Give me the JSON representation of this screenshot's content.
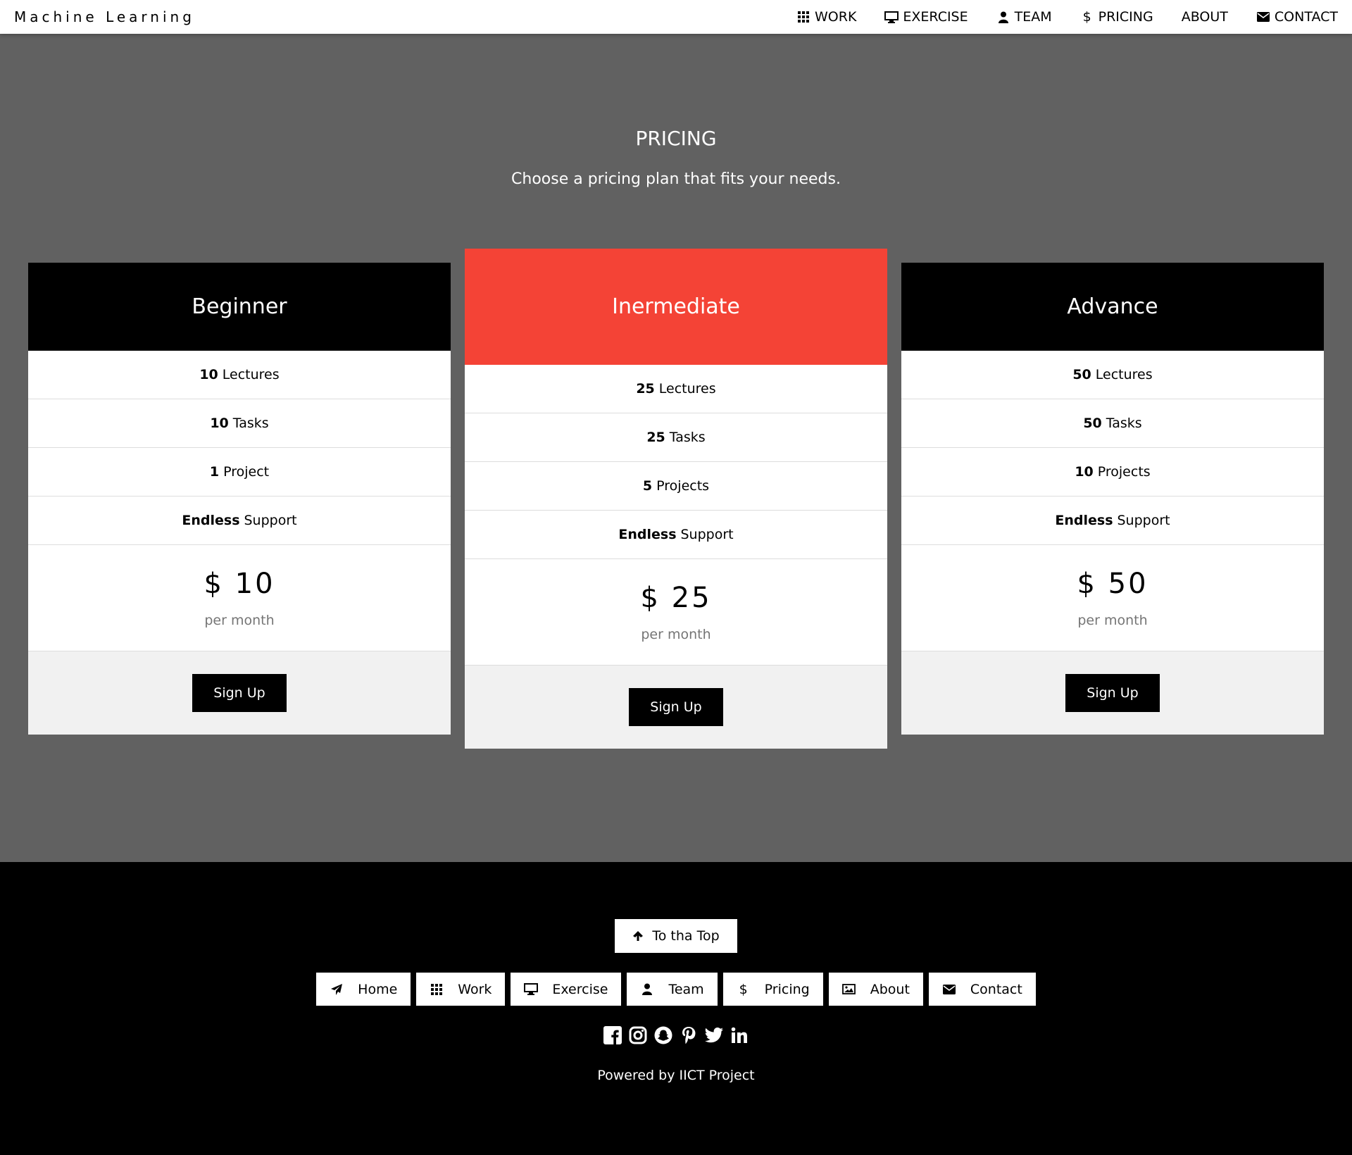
{
  "brand": "Machine Learning",
  "nav": [
    {
      "label": "WORK",
      "icon": "grid-icon"
    },
    {
      "label": "EXERCISE",
      "icon": "desktop-icon"
    },
    {
      "label": "TEAM",
      "icon": "user-icon"
    },
    {
      "label": "PRICING",
      "icon": "dollar-icon"
    },
    {
      "label": "ABOUT",
      "icon": ""
    },
    {
      "label": "CONTACT",
      "icon": "envelope-icon"
    }
  ],
  "pricing": {
    "title": "PRICING",
    "subtitle": "Choose a pricing plan that fits your needs."
  },
  "plans": [
    {
      "name": "Beginner",
      "features": [
        {
          "bold": "10",
          "text": "Lectures"
        },
        {
          "bold": "10",
          "text": "Tasks"
        },
        {
          "bold": "1",
          "text": "Project"
        },
        {
          "bold": "Endless",
          "text": "Support"
        }
      ],
      "price": "$ 10",
      "period": "per month",
      "button": "Sign Up"
    },
    {
      "name": "Inermediate",
      "features": [
        {
          "bold": "25",
          "text": "Lectures"
        },
        {
          "bold": "25",
          "text": "Tasks"
        },
        {
          "bold": "5",
          "text": "Projects"
        },
        {
          "bold": "Endless",
          "text": "Support"
        }
      ],
      "price": "$ 25",
      "period": "per month",
      "button": "Sign Up"
    },
    {
      "name": "Advance",
      "features": [
        {
          "bold": "50",
          "text": "Lectures"
        },
        {
          "bold": "50",
          "text": "Tasks"
        },
        {
          "bold": "10",
          "text": "Projects"
        },
        {
          "bold": "Endless",
          "text": "Support"
        }
      ],
      "price": "$ 50",
      "period": "per month",
      "button": "Sign Up"
    }
  ],
  "footer": {
    "to_top": "To tha Top",
    "links": [
      {
        "label": "Home",
        "icon": "paper-plane-icon"
      },
      {
        "label": "Work",
        "icon": "grid-icon"
      },
      {
        "label": "Exercise",
        "icon": "desktop-icon"
      },
      {
        "label": "Team",
        "icon": "user-icon"
      },
      {
        "label": "Pricing",
        "icon": "dollar-icon"
      },
      {
        "label": "About",
        "icon": "image-icon"
      },
      {
        "label": "Contact",
        "icon": "envelope-icon"
      }
    ],
    "social": [
      "facebook-icon",
      "instagram-icon",
      "snapchat-icon",
      "pinterest-icon",
      "twitter-icon",
      "linkedin-icon"
    ],
    "powered": "Powered by IICT Project"
  },
  "colors": {
    "background": "#616161",
    "highlight": "#f44336",
    "dark": "#000000",
    "light": "#f1f1f1"
  }
}
